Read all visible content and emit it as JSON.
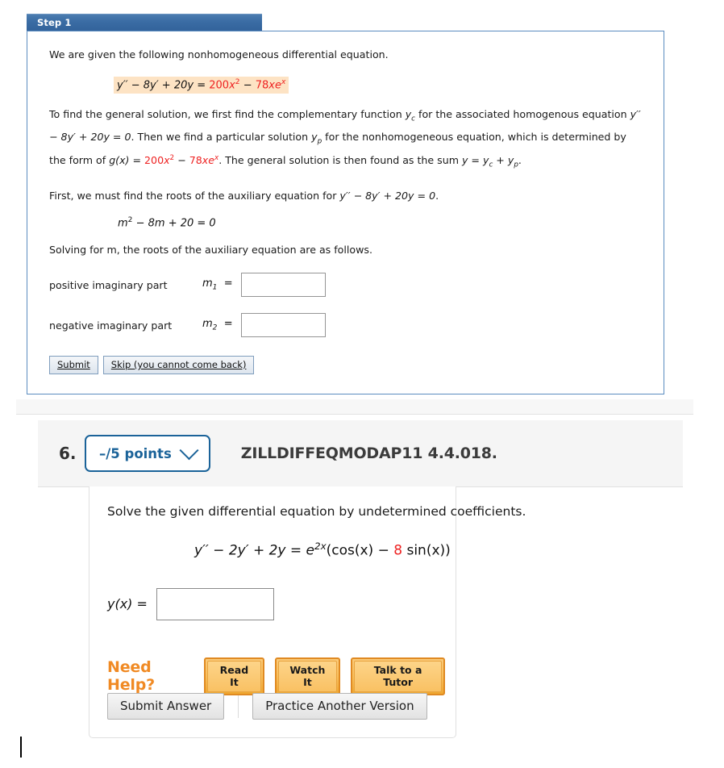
{
  "step_panel": {
    "tab_label": "Step 1",
    "intro": "We are given the following nonhomogeneous differential equation.",
    "main_equation": {
      "lhs": "y′′ − 8y′ + 20y =",
      "rhs_coef1": "200",
      "rhs_term1": "x",
      "rhs_exp1": "2",
      "rhs_op": "−",
      "rhs_coef2": "78",
      "rhs_term2": "xe",
      "rhs_exp2": "x"
    },
    "paragraph2": {
      "part1": "To find the general solution, we first find the complementary function ",
      "yc": "y",
      "yc_sub": "c",
      "part2": " for the associated homogenous equation ",
      "hom_eq": "y′′ − 8y′ + 20y = 0",
      "part3": ". Then we find a particular solution ",
      "yp": "y",
      "yp_sub": "p",
      "part4": " for the nonhomogeneous equation, which is determined by the form of ",
      "gx": "g(x) =",
      "gx_coef1": "200",
      "gx_term1": "x",
      "gx_exp1": "2",
      "gx_op": "−",
      "gx_coef2": "78",
      "gx_term2": "xe",
      "gx_exp2": "x",
      "part5": ". The general solution is then found as the sum ",
      "sum_y": "y",
      "sum_eq": " = ",
      "sum_yc": "y",
      "sum_yc_sub": "c",
      "sum_plus": " + ",
      "sum_yp": "y",
      "sum_yp_sub": "p",
      "sum_dot": "."
    },
    "paragraph3": {
      "text": "First, we must find the roots of the auxiliary equation for ",
      "equation": "y′′ − 8y′ + 20y = 0",
      "period": "."
    },
    "aux_equation": {
      "m": "m",
      "exp": "2",
      "rest": " − 8m + 20 = 0"
    },
    "paragraph4": "Solving for m, the roots of the auxiliary equation are as follows.",
    "answers": [
      {
        "label": "positive imaginary part",
        "symbol": "m",
        "subscript": "1",
        "equals": "=",
        "value": ""
      },
      {
        "label": "negative imaginary part",
        "symbol": "m",
        "subscript": "2",
        "equals": "=",
        "value": ""
      }
    ],
    "submit_label": "Submit",
    "skip_label": "Skip (you cannot come back)"
  },
  "question": {
    "number": "6.",
    "points_label": "–/5 points",
    "chevron_icon": "chevron-down-icon",
    "code": "ZILLDIFFEQMODAP11 4.4.018.",
    "prompt": "Solve the given differential equation by undetermined coefficients.",
    "equation": {
      "lhs": "y′′ − 2y′ + 2y = e",
      "exp": "2x",
      "open": "(cos(x) − ",
      "red_coef": "8",
      "close": " sin(x))"
    },
    "answer_label": "y(x) =",
    "answer_value": "",
    "need_help_label": "Need Help?",
    "help_buttons": [
      {
        "label": "Read It",
        "name": "read-it-button"
      },
      {
        "label": "Watch It",
        "name": "watch-it-button"
      },
      {
        "label": "Talk to a Tutor",
        "name": "talk-to-a-tutor-button"
      }
    ],
    "submit_answer_label": "Submit Answer",
    "practice_label": "Practice Another Version"
  },
  "colors": {
    "step_tab_blue": "#3a6ca4",
    "step_border_blue": "#5b8cc0",
    "highlight_peach": "#fde3c4",
    "math_red": "#ee2222",
    "badge_blue": "#1b6399",
    "help_orange": "#f08a24"
  }
}
